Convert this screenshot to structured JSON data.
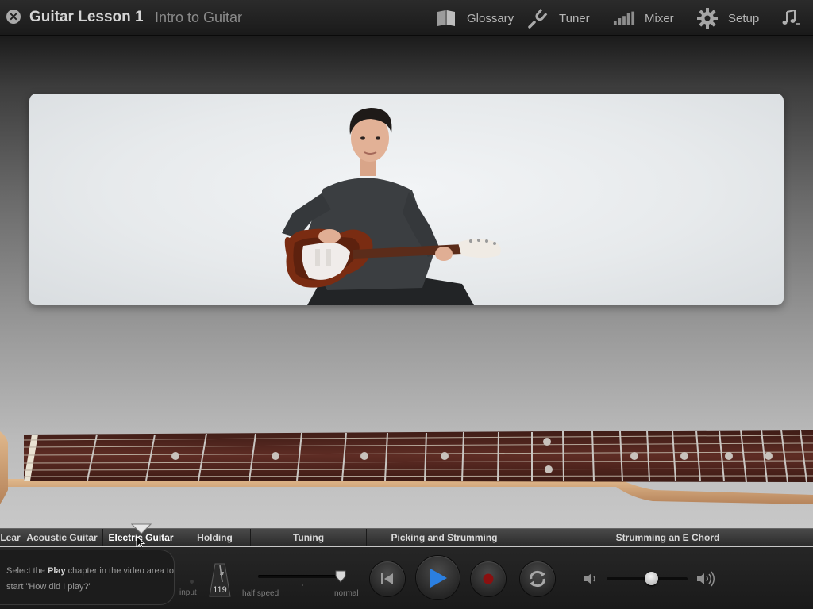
{
  "header": {
    "title": "Guitar Lesson 1",
    "subtitle": "Intro to Guitar",
    "close_icon": "close-icon",
    "tools": [
      {
        "label": "Glossary",
        "icon": "book-icon"
      },
      {
        "label": "Tuner",
        "icon": "tuning-fork-icon"
      },
      {
        "label": "Mixer",
        "icon": "mixer-icon"
      },
      {
        "label": "Setup",
        "icon": "gear-icon"
      },
      {
        "label": "",
        "icon": "music-notes-icon"
      }
    ]
  },
  "chapters": [
    {
      "label": "Lear"
    },
    {
      "label": "Acoustic Guitar"
    },
    {
      "label": "Electric Guitar"
    },
    {
      "label": "Holding"
    },
    {
      "label": "Tuning"
    },
    {
      "label": "Picking and Strumming"
    },
    {
      "label": "Strumming an E Chord"
    }
  ],
  "hint": {
    "prefix": "Select the ",
    "bold": "Play",
    "suffix": " chapter in the video area to start \"How did I play?\""
  },
  "controls": {
    "input_label": "input",
    "tempo": "119",
    "speed_left_label": "half speed",
    "speed_right_label": "normal",
    "speed_value": "normal",
    "volume_level": 0.55
  },
  "colors": {
    "play_accent": "#2b7fe0",
    "record": "#8a1010",
    "fretboard": "#5a2a24"
  }
}
